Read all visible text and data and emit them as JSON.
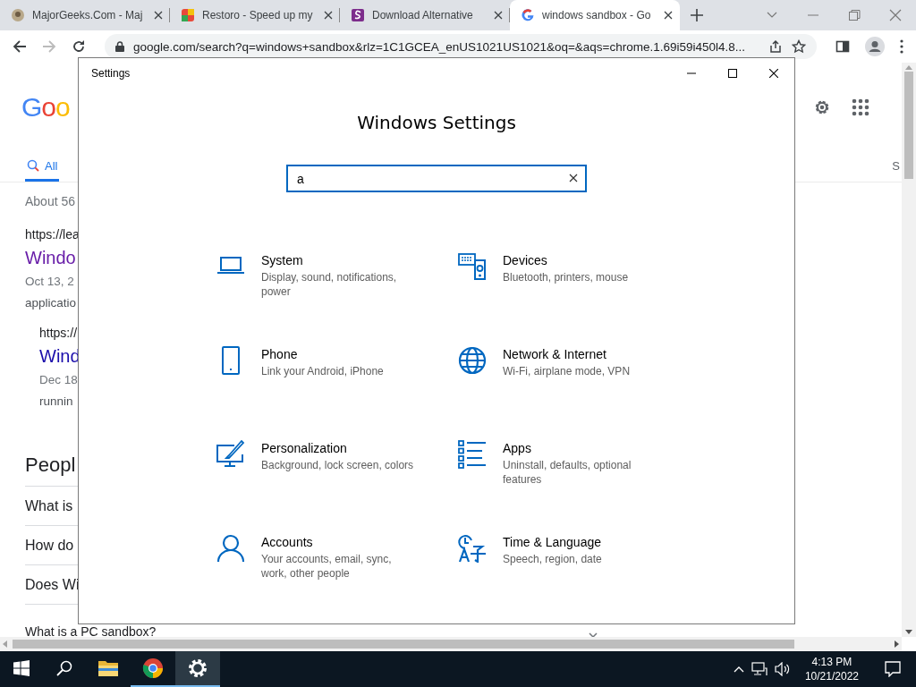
{
  "browser": {
    "tabs": [
      {
        "title": "MajorGeeks.Com - Maj",
        "kind": "majorgeeks",
        "selected": false
      },
      {
        "title": "Restoro - Speed up my",
        "kind": "restoro",
        "selected": false
      },
      {
        "title": "Download Alternative",
        "kind": "softpedia",
        "selected": false
      },
      {
        "title": "windows sandbox - Go",
        "kind": "google",
        "selected": true
      }
    ],
    "address": "google.com/search?q=windows+sandbox&rlz=1C1GCEA_enUS1021US1021&oq=&aqs=chrome.1.69i59i450l4.8..."
  },
  "page": {
    "logo": "Goo",
    "tabs": [
      {
        "label": "All",
        "selected": true
      },
      {
        "label": "S",
        "selected": false
      }
    ],
    "result_count": "About 56",
    "results": [
      {
        "url": "https://lea",
        "title": "Windo",
        "snippet": [
          "Oct 13, 2",
          "applicatio"
        ],
        "children": [
          {
            "url": "https://",
            "title": "Wind",
            "snippet": [
              "Dec 18",
              "runnin"
            ]
          }
        ]
      }
    ],
    "people_also_ask": {
      "heading": "Peopl",
      "questions": [
        "What is",
        "How do",
        "Does Wi",
        "What is a PC sandbox?"
      ]
    }
  },
  "settings_window": {
    "title": "Settings",
    "heading": "Windows Settings",
    "search": {
      "value": "a"
    },
    "categories": [
      {
        "kind": "system",
        "name": "System",
        "description": "Display, sound, notifications, power"
      },
      {
        "kind": "devices",
        "name": "Devices",
        "description": "Bluetooth, printers, mouse"
      },
      {
        "kind": "phone",
        "name": "Phone",
        "description": "Link your Android, iPhone"
      },
      {
        "kind": "network",
        "name": "Network & Internet",
        "description": "Wi-Fi, airplane mode, VPN"
      },
      {
        "kind": "personalization",
        "name": "Personalization",
        "description": "Background, lock screen, colors"
      },
      {
        "kind": "apps",
        "name": "Apps",
        "description": "Uninstall, defaults, optional features"
      },
      {
        "kind": "accounts",
        "name": "Accounts",
        "description": "Your accounts, email, sync, work, other people"
      },
      {
        "kind": "time",
        "name": "Time & Language",
        "description": "Speech, region, date"
      }
    ]
  },
  "taskbar": {
    "apps": [
      {
        "kind": "files",
        "running": false,
        "selected": false
      },
      {
        "kind": "chrome",
        "running": true,
        "selected": false
      },
      {
        "kind": "settings",
        "running": true,
        "selected": true
      }
    ],
    "time": "4:13 PM",
    "date": "10/21/2022"
  }
}
